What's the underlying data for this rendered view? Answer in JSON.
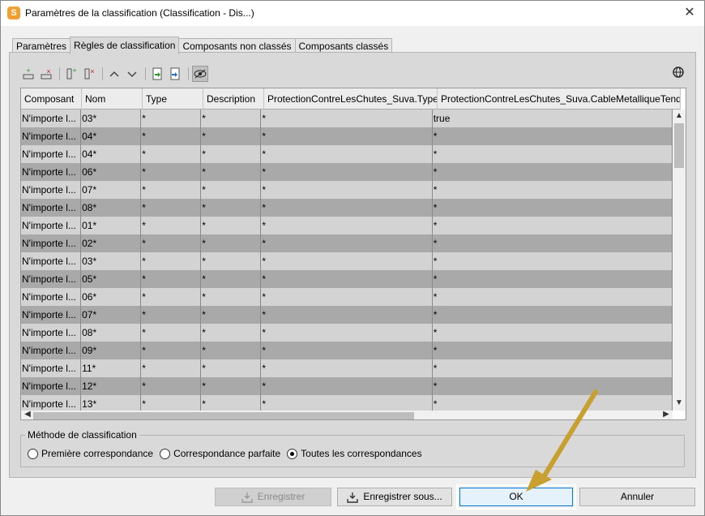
{
  "window": {
    "title": "Paramètres de la classification (Classification - Dis...)",
    "app_icon_letter": "S"
  },
  "tabs": [
    {
      "label": "Paramètres"
    },
    {
      "label": "Règles de classification"
    },
    {
      "label": "Composants non classés"
    },
    {
      "label": "Composants classés"
    }
  ],
  "grid": {
    "headers": [
      "Composant",
      "Nom",
      "Type",
      "Description",
      "ProtectionContreLesChutes_Suva.Type",
      "ProtectionContreLesChutes_Suva.CableMetalliqueTend"
    ],
    "rows": [
      [
        "N'importe l...",
        "03*",
        "*",
        "*",
        "*",
        "true"
      ],
      [
        "N'importe l...",
        "04*",
        "*",
        "*",
        "*",
        "*"
      ],
      [
        "N'importe l...",
        "04*",
        "*",
        "*",
        "*",
        "*"
      ],
      [
        "N'importe l...",
        "06*",
        "*",
        "*",
        "*",
        "*"
      ],
      [
        "N'importe l...",
        "07*",
        "*",
        "*",
        "*",
        "*"
      ],
      [
        "N'importe l...",
        "08*",
        "*",
        "*",
        "*",
        "*"
      ],
      [
        "N'importe l...",
        "01*",
        "*",
        "*",
        "*",
        "*"
      ],
      [
        "N'importe l...",
        "02*",
        "*",
        "*",
        "*",
        "*"
      ],
      [
        "N'importe l...",
        "03*",
        "*",
        "*",
        "*",
        "*"
      ],
      [
        "N'importe l...",
        "05*",
        "*",
        "*",
        "*",
        "*"
      ],
      [
        "N'importe l...",
        "06*",
        "*",
        "*",
        "*",
        "*"
      ],
      [
        "N'importe l...",
        "07*",
        "*",
        "*",
        "*",
        "*"
      ],
      [
        "N'importe l...",
        "08*",
        "*",
        "*",
        "*",
        "*"
      ],
      [
        "N'importe l...",
        "09*",
        "*",
        "*",
        "*",
        "*"
      ],
      [
        "N'importe l...",
        "11*",
        "*",
        "*",
        "*",
        "*"
      ],
      [
        "N'importe l...",
        "12*",
        "*",
        "*",
        "*",
        "*"
      ],
      [
        "N'importe l...",
        "13*",
        "*",
        "*",
        "*",
        "*"
      ]
    ]
  },
  "method": {
    "label": "Méthode de classification",
    "options": [
      {
        "label": "Première correspondance",
        "selected": false
      },
      {
        "label": "Correspondance parfaite",
        "selected": false
      },
      {
        "label": "Toutes les correspondances",
        "selected": true
      }
    ]
  },
  "buttons": {
    "save": "Enregistrer",
    "save_as": "Enregistrer sous...",
    "ok": "OK",
    "cancel": "Annuler"
  },
  "colors": {
    "arrow": "#c8a030",
    "accent": "#0078d7",
    "row_light": "#d3d3d3",
    "row_dark": "#a9a9a9"
  }
}
